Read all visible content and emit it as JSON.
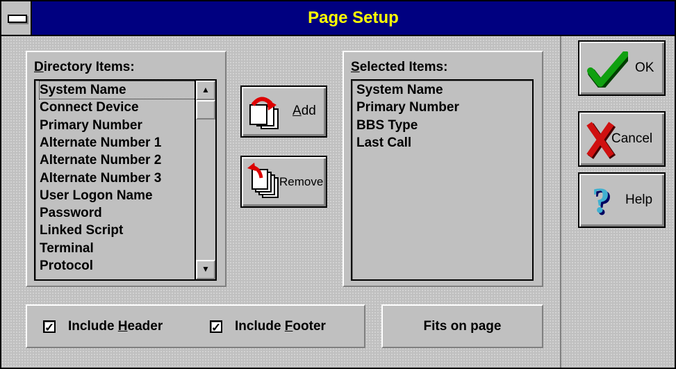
{
  "window": {
    "title": "Page Setup"
  },
  "directory": {
    "label": "Directory Items:",
    "items": [
      "System Name",
      "Connect Device",
      "Primary Number",
      "Alternate Number 1",
      "Alternate Number 2",
      "Alternate Number 3",
      "User Logon Name",
      "Password",
      "Linked Script",
      "Terminal",
      "Protocol"
    ],
    "scroll_up": "▲",
    "scroll_down": "▼"
  },
  "selected": {
    "label": "Selected Items:",
    "items": [
      "System Name",
      "Primary Number",
      "BBS Type",
      "Last Call"
    ]
  },
  "buttons": {
    "add": "Add",
    "remove": "Remove",
    "ok": "OK",
    "cancel": "Cancel",
    "help": "Help"
  },
  "options": {
    "include_header": "Include Header",
    "include_footer": "Include Footer",
    "header_checked": "✓",
    "footer_checked": "✓"
  },
  "status": {
    "fits": "Fits on page"
  },
  "icons": [
    "system-menu-icon",
    "add-pages-icon",
    "remove-pages-icon",
    "checkmark-icon",
    "x-icon",
    "question-mark-icon"
  ]
}
